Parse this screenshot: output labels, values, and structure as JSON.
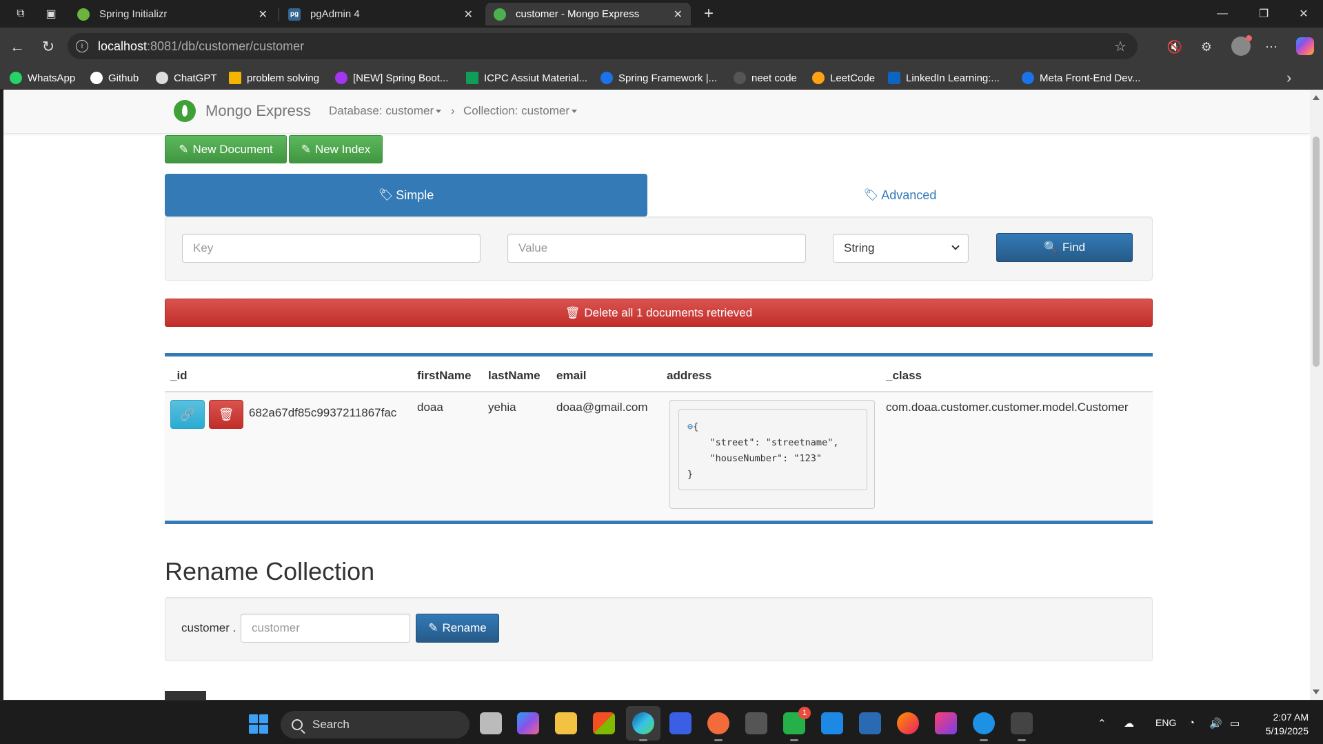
{
  "browser": {
    "tabs": [
      {
        "title": "Spring Initializr",
        "favicon": "spring-leaf-icon",
        "active": false
      },
      {
        "title": "pgAdmin 4",
        "favicon": "pg",
        "active": false
      },
      {
        "title": "customer - Mongo Express",
        "favicon": "mongo-leaf-icon",
        "active": true
      }
    ],
    "url_host": "localhost",
    "url_path": ":8081/db/customer/customer",
    "bookmarks": [
      {
        "label": "WhatsApp",
        "color": "#25d366"
      },
      {
        "label": "Github",
        "color": "#ffffff"
      },
      {
        "label": "ChatGPT",
        "color": "#ffffff"
      },
      {
        "label": "problem solving",
        "color": "#f4b400"
      },
      {
        "label": "[NEW] Spring Boot...",
        "color": "#a435f0"
      },
      {
        "label": "ICPC Assiut Material...",
        "color": "#0f9d58"
      },
      {
        "label": "Spring Framework |...",
        "color": "#1a73e8"
      },
      {
        "label": "neet code",
        "color": "#cccccc"
      },
      {
        "label": "LeetCode",
        "color": "#ffa116"
      },
      {
        "label": "LinkedIn Learning:...",
        "color": "#0a66c2"
      },
      {
        "label": "Meta Front-End Dev...",
        "color": "#1a73e8"
      }
    ]
  },
  "app": {
    "brand": "Mongo Express",
    "database_crumb": "Database: customer",
    "collection_crumb": "Collection: customer",
    "new_document_label": "New Document",
    "new_index_label": "New Index",
    "tab_simple": "Simple",
    "tab_advanced": "Advanced",
    "key_placeholder": "Key",
    "value_placeholder": "Value",
    "type_selected": "String",
    "find_label": "Find",
    "delete_all_label": "Delete all 1 documents retrieved",
    "columns": [
      "_id",
      "firstName",
      "lastName",
      "email",
      "address",
      "_class"
    ],
    "rows": [
      {
        "id": "682a67df85c9937211867fac",
        "firstName": "doaa",
        "lastName": "yehia",
        "email": "doaa@gmail.com",
        "address_lines": [
          "{",
          "    \"street\": \"streetname\",",
          "    \"houseNumber\": \"123\"",
          "}"
        ],
        "class": "com.doaa.customer.customer.model.Customer"
      }
    ],
    "rename_title": "Rename Collection",
    "rename_prefix": "customer .",
    "rename_placeholder": "customer",
    "rename_label": "Rename"
  },
  "taskbar": {
    "search_label": "Search",
    "notification_count": "1",
    "language": "ENG",
    "time": "2:07 AM",
    "date": "5/19/2025"
  },
  "colors": {
    "primary": "#337ab7",
    "success": "#5cb85c",
    "danger": "#d9534f",
    "info": "#5bc0de"
  }
}
